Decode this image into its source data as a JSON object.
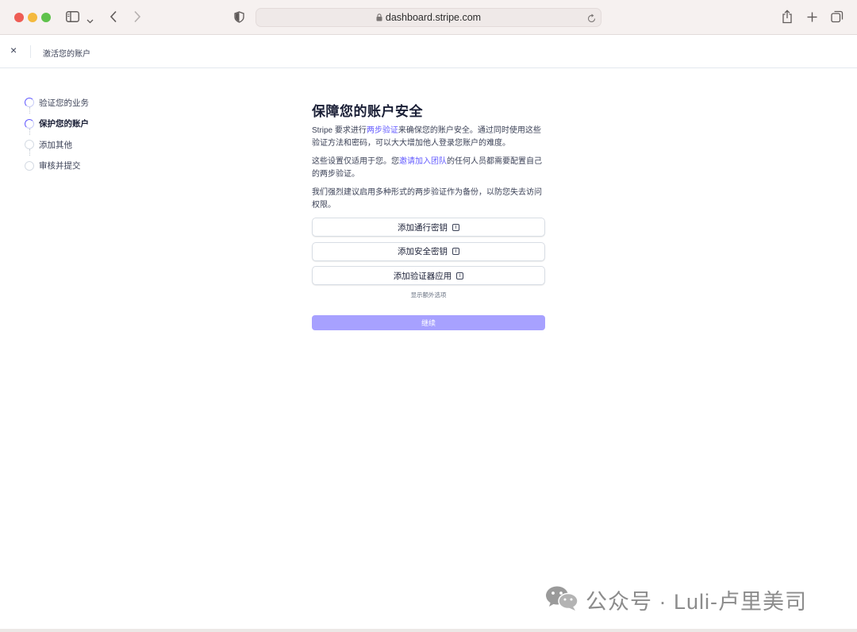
{
  "browser": {
    "url": "dashboard.stripe.com",
    "icons": [
      "sidebar-icon",
      "chevron-down-icon",
      "back-icon",
      "forward-icon",
      "shield-icon",
      "lock-icon",
      "reload-icon",
      "share-icon",
      "new-tab-icon",
      "tabs-overview-icon"
    ]
  },
  "topbar": {
    "close_label": "×",
    "title": "激活您的账户"
  },
  "steps": [
    {
      "label": "验证您的业务",
      "state": "in-progress"
    },
    {
      "label": "保护您的账户",
      "state": "current"
    },
    {
      "label": "添加其他",
      "state": "pending"
    },
    {
      "label": "审核并提交",
      "state": "pending"
    }
  ],
  "main": {
    "heading": "保障您的账户安全",
    "para1_prefix": "Stripe 要求进行",
    "para1_link": "两步验证",
    "para1_suffix": "来确保您的账户安全。通过同时使用这些验证方法和密码，可以大大增加他人登录您账户的难度。",
    "para2_prefix": "这些设置仅适用于您。您",
    "para2_link": "邀请加入团队",
    "para2_suffix": "的任何人员都需要配置自己的两步验证。",
    "para3": "我们强烈建议启用多种形式的两步验证作为备份，以防您失去访问权限。",
    "options": [
      {
        "label": "添加通行密钥",
        "icon": "info-icon"
      },
      {
        "label": "添加安全密钥",
        "icon": "info-icon"
      },
      {
        "label": "添加验证器应用",
        "icon": "info-icon"
      }
    ],
    "more_options": "显示额外选项",
    "continue": "继续"
  },
  "colors": {
    "accent": "#635bff",
    "continue_disabled": "#a7a1ff",
    "text": "#1a1f36"
  },
  "watermark": {
    "text": "公众号 · Luli-卢里美司",
    "icon": "wechat-icon"
  }
}
